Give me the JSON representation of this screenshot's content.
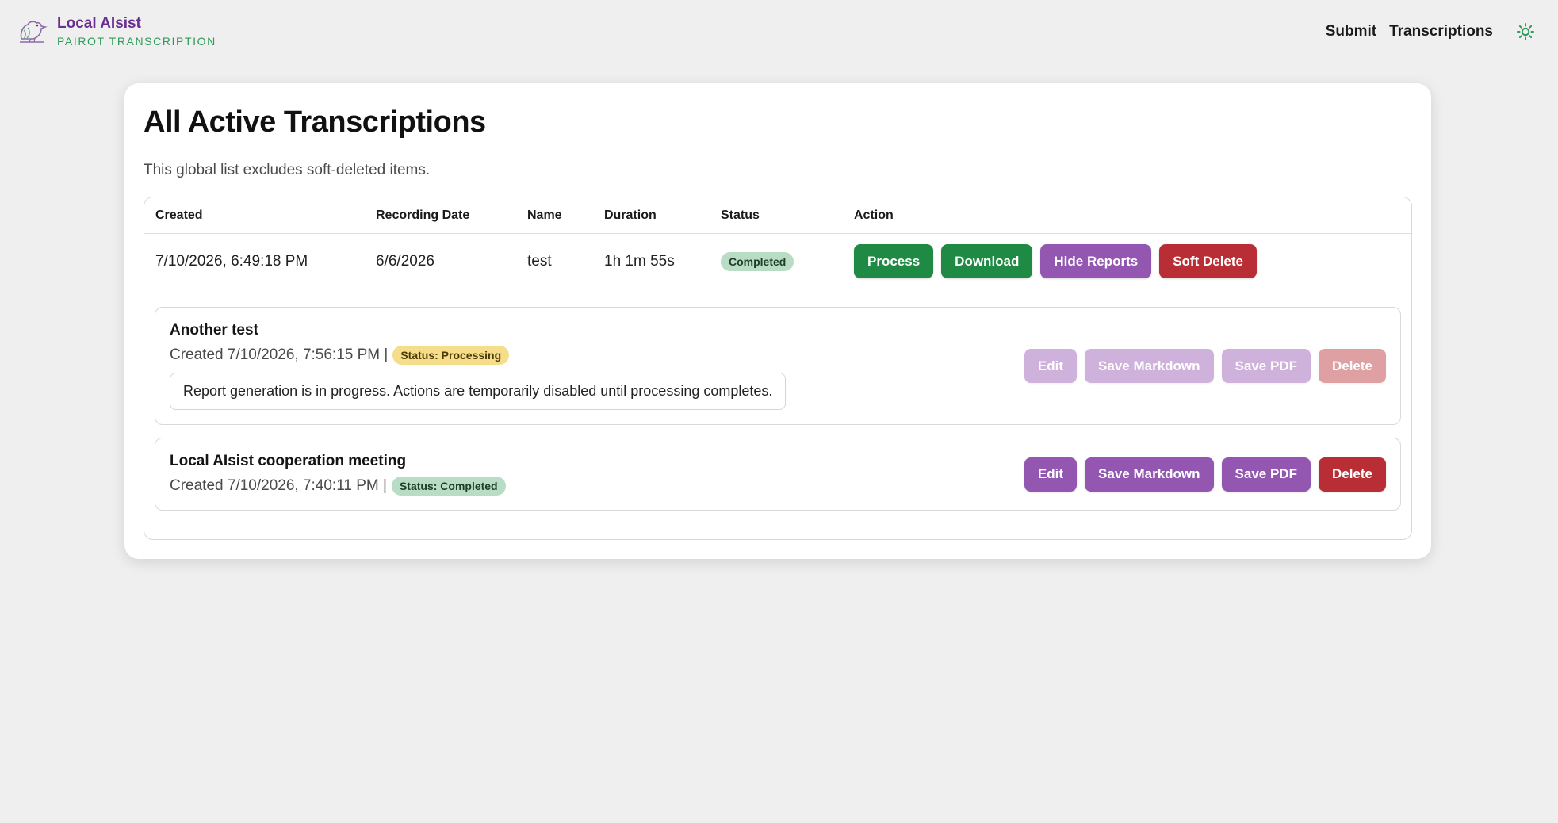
{
  "header": {
    "brand_name": "Local AIsist",
    "brand_sub": "PAIROT TRANSCRIPTION",
    "nav": [
      "Submit",
      "Transcriptions"
    ],
    "logo_icon": "parrot-logo-icon",
    "theme_icon": "sun-icon"
  },
  "page": {
    "title": "All Active Transcriptions",
    "subtitle": "This global list excludes soft-deleted items."
  },
  "table": {
    "columns": [
      "Created",
      "Recording Date",
      "Name",
      "Duration",
      "Status",
      "Action"
    ],
    "rows": [
      {
        "created": "7/10/2026, 6:49:18 PM",
        "recording_date": "6/6/2026",
        "name": "test",
        "duration": "1h 1m 55s",
        "status": "Completed",
        "actions": [
          "Process",
          "Download",
          "Hide Reports",
          "Soft Delete"
        ]
      }
    ]
  },
  "reports": [
    {
      "title": "Another test",
      "created": "Created 7/10/2026, 7:56:15 PM |",
      "status": "Status: Processing",
      "note": "Report generation is in progress. Actions are temporarily disabled until processing completes.",
      "actions": [
        "Edit",
        "Save Markdown",
        "Save PDF",
        "Delete"
      ],
      "disabled": true
    },
    {
      "title": "Local AIsist cooperation meeting",
      "created": "Created 7/10/2026, 7:40:11 PM |",
      "status": "Status: Completed",
      "actions": [
        "Edit",
        "Save Markdown",
        "Save PDF",
        "Delete"
      ],
      "disabled": false
    }
  ],
  "colors": {
    "brand_purple": "#6a2d91",
    "brand_green": "#2e9a57",
    "btn_green": "#1f8a43",
    "btn_purple": "#9357b1",
    "btn_red": "#b92e35",
    "badge_completed": "#b9dcc4",
    "badge_processing": "#f6dd8a"
  }
}
